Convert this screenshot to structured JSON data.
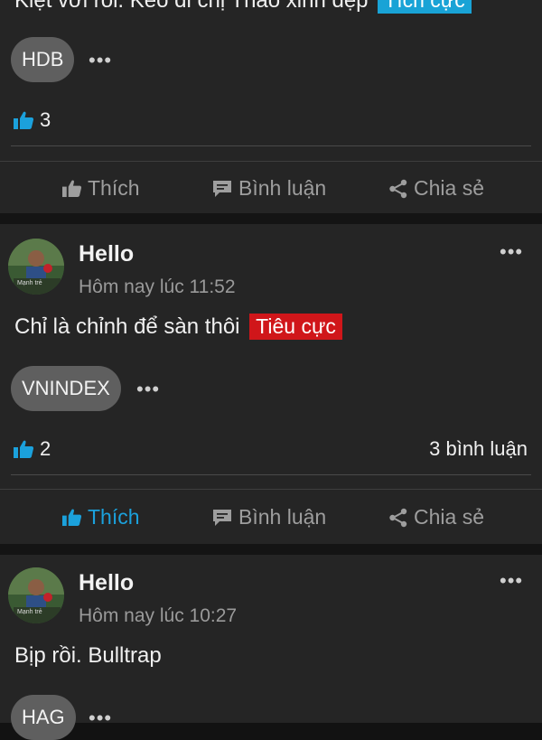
{
  "colors": {
    "background": "#121212",
    "card": "#252525",
    "accent": "#1ba1dc",
    "positive_tag": "#19a3d6",
    "negative_tag": "#d0161a",
    "muted": "#9e9e9e"
  },
  "posts": [
    {
      "text": "Kiệt vời rồi. Kéo đi chị Thảo xinh đẹp",
      "sentiment": "Tích cực",
      "ticker": "HDB",
      "likes": "3",
      "comments": "",
      "liked": false
    },
    {
      "author": "Hello",
      "time": "Hôm nay lúc 11:52",
      "avatar_caption": "Mạnh trẻ",
      "text": "Chỉ là chỉnh để sàn thôi",
      "sentiment": "Tiêu cực",
      "ticker": "VNINDEX",
      "likes": "2",
      "comments": "3 bình luận",
      "liked": true
    },
    {
      "author": "Hello",
      "time": "Hôm nay lúc 10:27",
      "avatar_caption": "Mạnh trẻ",
      "text": "Bịp rồi. Bulltrap",
      "ticker": "HAG"
    }
  ],
  "actions": {
    "like": "Thích",
    "comment": "Bình luận",
    "share": "Chia sẻ"
  },
  "icons": {
    "more": "more-horizontal-icon",
    "like": "thumbs-up-icon",
    "comment": "comment-bubble-icon",
    "share": "share-icon"
  }
}
